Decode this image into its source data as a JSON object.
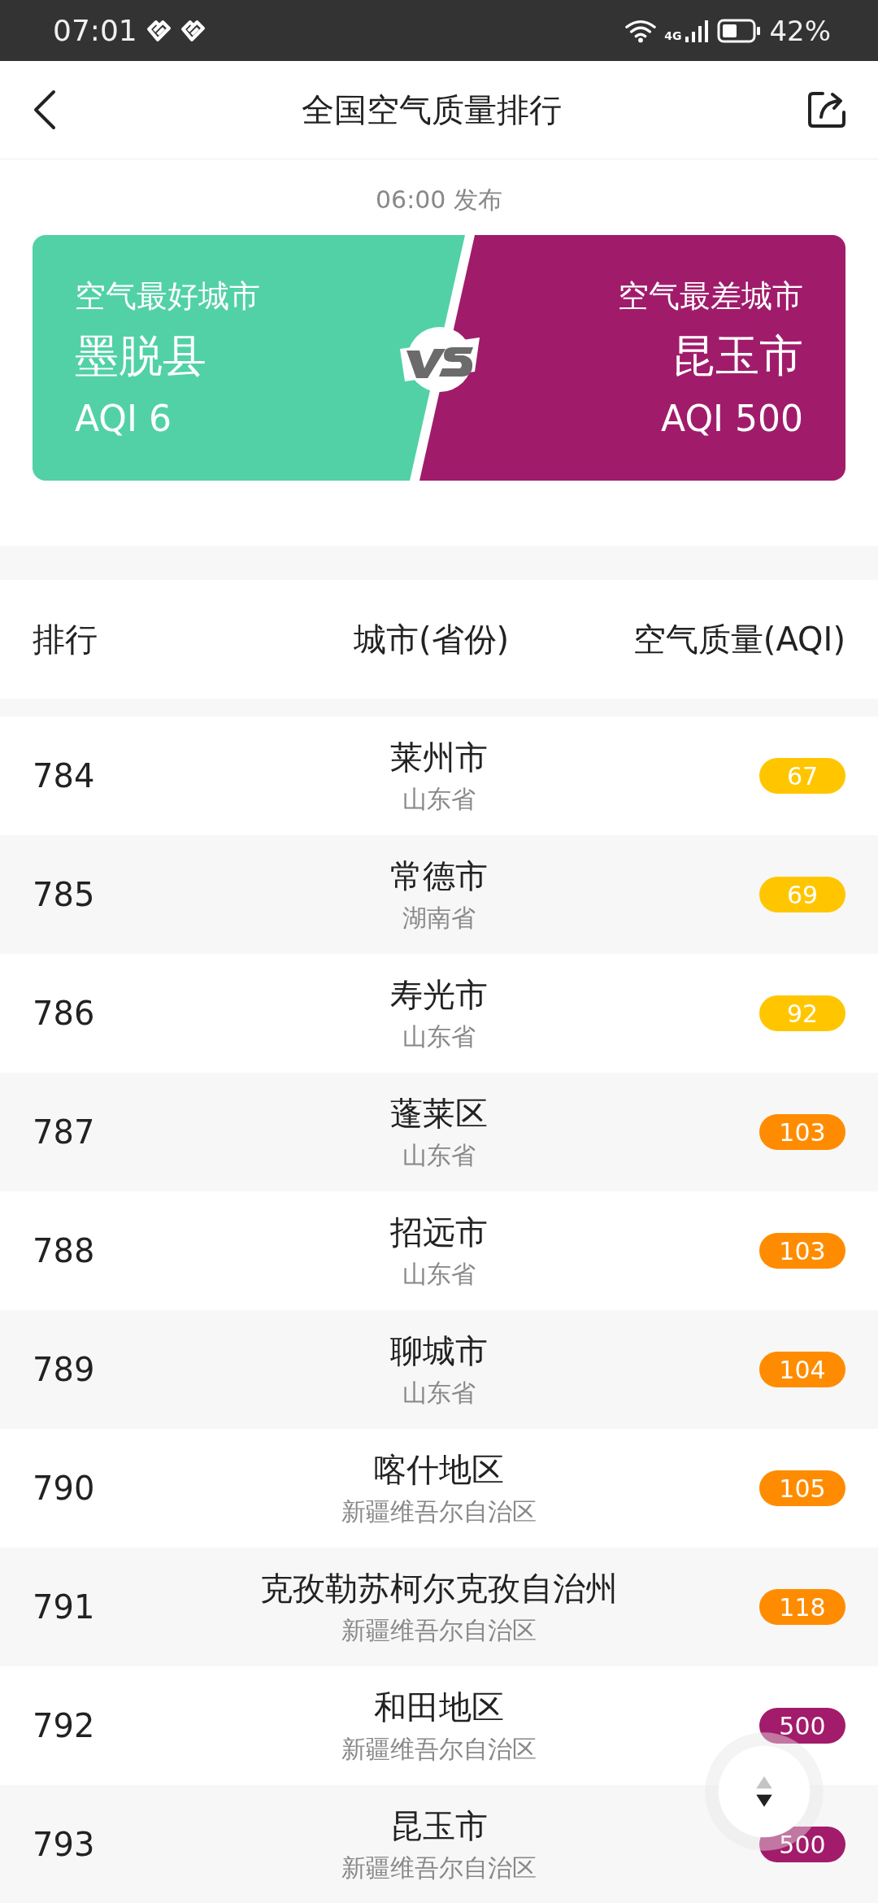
{
  "status_bar": {
    "time": "07:01",
    "network": "4G",
    "battery": "42%"
  },
  "header": {
    "title": "全国空气质量排行"
  },
  "published": "06:00 发布",
  "best": {
    "label": "空气最好城市",
    "city": "墨脱县",
    "aqi": "AQI 6"
  },
  "worst": {
    "label": "空气最差城市",
    "city": "昆玉市",
    "aqi": "AQI 500"
  },
  "columns": [
    "排行",
    "城市(省份)",
    "空气质量(AQI)"
  ],
  "rows": [
    {
      "rank": "784",
      "city": "莱州市",
      "province": "山东省",
      "aqi": "67",
      "color": "#ffc600"
    },
    {
      "rank": "785",
      "city": "常德市",
      "province": "湖南省",
      "aqi": "69",
      "color": "#ffc600"
    },
    {
      "rank": "786",
      "city": "寿光市",
      "province": "山东省",
      "aqi": "92",
      "color": "#ffc600"
    },
    {
      "rank": "787",
      "city": "蓬莱区",
      "province": "山东省",
      "aqi": "103",
      "color": "#ff8c00"
    },
    {
      "rank": "788",
      "city": "招远市",
      "province": "山东省",
      "aqi": "103",
      "color": "#ff8c00"
    },
    {
      "rank": "789",
      "city": "聊城市",
      "province": "山东省",
      "aqi": "104",
      "color": "#ff8c00"
    },
    {
      "rank": "790",
      "city": "喀什地区",
      "province": "新疆维吾尔自治区",
      "aqi": "105",
      "color": "#ff8c00"
    },
    {
      "rank": "791",
      "city": "克孜勒苏柯尔克孜自治州",
      "province": "新疆维吾尔自治区",
      "aqi": "118",
      "color": "#ff8c00"
    },
    {
      "rank": "792",
      "city": "和田地区",
      "province": "新疆维吾尔自治区",
      "aqi": "500",
      "color": "#a21c6b"
    },
    {
      "rank": "793",
      "city": "昆玉市",
      "province": "新疆维吾尔自治区",
      "aqi": "500",
      "color": "#a21c6b"
    }
  ]
}
